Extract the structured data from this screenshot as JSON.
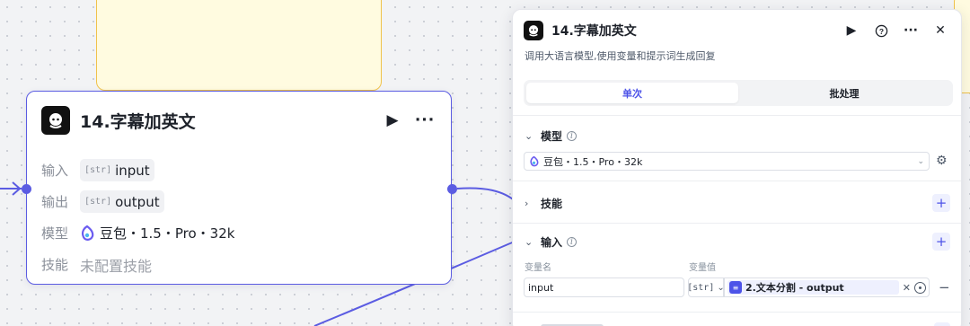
{
  "canvas": {
    "node": {
      "title": "14.字幕加英文",
      "icon": "llm-bot-icon",
      "run_icon": "play-icon",
      "more_icon": "more-icon",
      "rows": {
        "input_label": "输入",
        "input_type": "[str]",
        "input_value": "input",
        "output_label": "输出",
        "output_type": "[str]",
        "output_value": "output",
        "model_label": "模型",
        "model_value": "豆包・1.5・Pro・32k",
        "skill_label": "技能",
        "skill_value": "未配置技能"
      }
    }
  },
  "panel": {
    "title": "14.字幕加英文",
    "description": "调用大语言模型,使用变量和提示词生成回复",
    "tabs": [
      {
        "label": "单次",
        "active": true
      },
      {
        "label": "批处理",
        "active": false
      }
    ],
    "model_section": {
      "title": "模型",
      "selected": "豆包・1.5・Pro・32k"
    },
    "skill_section": {
      "title": "技能"
    },
    "input_section": {
      "title": "输入",
      "col_name": "变量名",
      "col_value": "变量值",
      "var_name": "input",
      "var_type": "[str]",
      "ref_value": "2.文本分割 - output"
    }
  },
  "colors": {
    "accent": "#5b5ce2",
    "tab_active": "#4d53e8",
    "node_yellow_bg": "#fffbe0",
    "node_yellow_border": "#f0c24a"
  }
}
